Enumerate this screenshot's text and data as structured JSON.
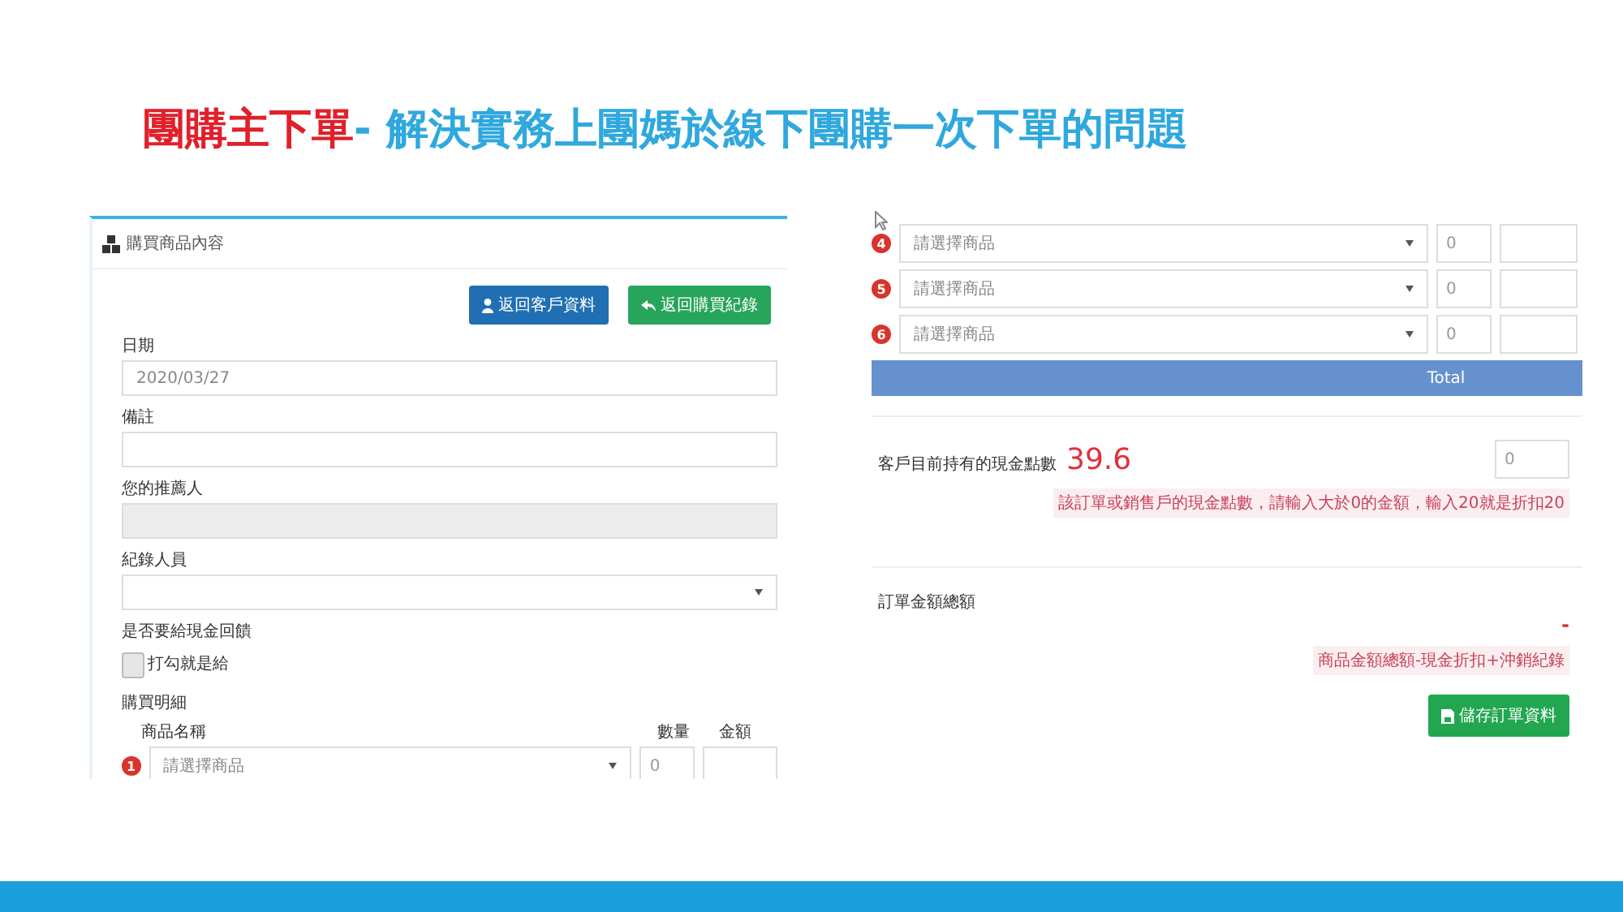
{
  "slide": {
    "title_red": "團購主下單",
    "title_blue": "- 解決實務上團媽於線下團購一次下單的問題"
  },
  "left_panel": {
    "title": "購買商品內容",
    "buttons": [
      {
        "label": "返回客戶資料",
        "kind": "customer"
      },
      {
        "label": "返回購買紀錄",
        "kind": "back"
      }
    ],
    "fields": [
      {
        "kind": "text",
        "label": "日期",
        "value": "2020/03/27"
      },
      {
        "kind": "text",
        "label": "備註"
      },
      {
        "kind": "disabled",
        "label": "您的推薦人"
      },
      {
        "kind": "select",
        "label": "紀錄人員"
      },
      {
        "kind": "checkbox",
        "label": "是否要給現金回饋",
        "option": "打勾就是給",
        "checked": false
      }
    ],
    "details": {
      "label": "購買明細",
      "columns": [
        "商品名稱",
        "數量",
        "金額"
      ],
      "rows": [
        {
          "number": "1",
          "placeholder": "請選擇商品",
          "quantity": "0"
        }
      ]
    }
  },
  "right_panel": {
    "rows": [
      {
        "number": "4",
        "placeholder": "請選擇商品",
        "quantity": "0"
      },
      {
        "number": "5",
        "placeholder": "請選擇商品",
        "quantity": "0"
      },
      {
        "number": "6",
        "placeholder": "請選擇商品",
        "quantity": "0"
      }
    ],
    "total_label": "Total",
    "points": {
      "label": "客戶目前持有的現金點數",
      "value": "39.6",
      "input": "0",
      "hint": "該訂單或銷售戶的現金點數，請輸入大於0的金額，輸入20就是折扣20"
    },
    "order_total": {
      "label": "訂單金額總額",
      "value": "-",
      "hint": "商品金額總額-現金折扣+沖銷紀錄"
    },
    "save_button": "儲存訂單資料"
  }
}
